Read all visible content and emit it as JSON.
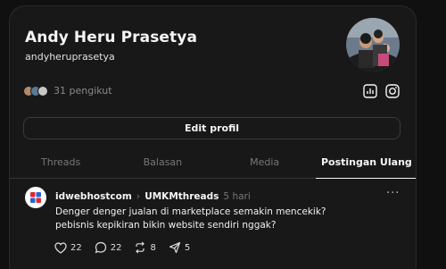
{
  "profile": {
    "display_name": "Andy Heru Prasetya",
    "username": "andyheruprasetya",
    "followers_text": "31 pengikut",
    "edit_label": "Edit profil"
  },
  "tabs": [
    {
      "label": "Threads"
    },
    {
      "label": "Balasan"
    },
    {
      "label": "Media"
    },
    {
      "label": "Postingan Ulang",
      "active": true
    }
  ],
  "post": {
    "author": "idwebhostcom",
    "repost_of": "UMKMthreads",
    "time": "5 hari",
    "line1": "Denger denger jualan di marketplace semakin mencekik?",
    "line2": "pebisnis kepikiran bikin website sendiri nggak?",
    "likes": "22",
    "replies": "22",
    "reposts": "8",
    "shares": "5"
  },
  "icons": {
    "insights": "bar-chart-icon",
    "instagram": "instagram-icon",
    "more": "more-dots-icon"
  },
  "colors": {
    "background": "#101010",
    "panel": "#181818",
    "text_primary": "#f3f5f7",
    "text_secondary": "#777777",
    "brand_red": "#e3262f",
    "brand_blue": "#2b62d9"
  }
}
